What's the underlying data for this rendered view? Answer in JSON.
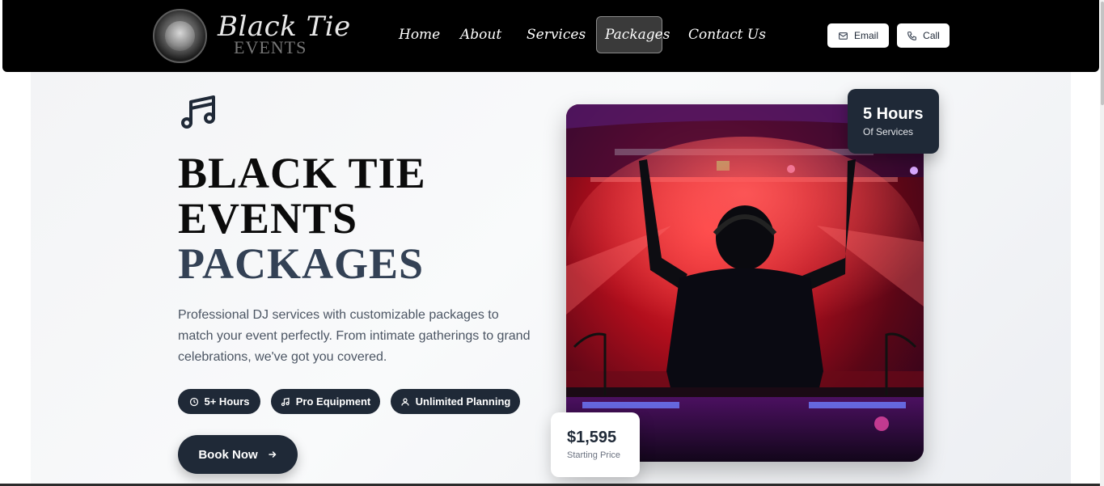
{
  "brand": {
    "script": "Black Tie",
    "sub": "EVENTS"
  },
  "nav": {
    "links": [
      {
        "label": "Home"
      },
      {
        "label": "About"
      },
      {
        "label": "Services"
      },
      {
        "label": "Packages"
      },
      {
        "label": "Contact Us"
      }
    ],
    "active": "Packages",
    "email_label": "Email",
    "call_label": "Call"
  },
  "hero": {
    "title_line1": "BLACK TIE",
    "title_line2": "EVENTS",
    "title_line3": "PACKAGES",
    "description": "Professional DJ services with customizable packages to match your event perfectly. From intimate gatherings to grand celebrations, we've got you covered.",
    "features": [
      {
        "label": "5+ Hours",
        "icon": "clock-icon"
      },
      {
        "label": "Pro Equipment",
        "icon": "music-note-icon"
      },
      {
        "label": "Unlimited Planning",
        "icon": "users-icon"
      }
    ],
    "cta_label": "Book Now"
  },
  "stat_card": {
    "value": "5 Hours",
    "caption": "Of Services"
  },
  "price_card": {
    "value": "$1,595",
    "caption": "Starting Price"
  },
  "colors": {
    "navbar": "#000000",
    "accent_dark": "#1f2937",
    "title_muted": "#334155"
  }
}
